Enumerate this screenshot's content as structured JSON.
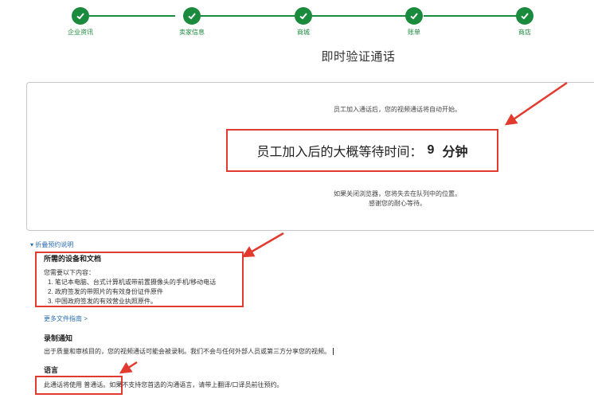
{
  "stepper": {
    "steps": [
      {
        "label": "企业资讯"
      },
      {
        "label": "卖家信息"
      },
      {
        "label": "商城"
      },
      {
        "label": "账单"
      },
      {
        "label": "商店"
      }
    ]
  },
  "page_title": "即时验证通话",
  "status_card": {
    "started_text": "员工加入通话后，您的视频通话将自动开始。",
    "wait_label": "员工加入后的大概等待时间：",
    "wait_value": "9",
    "wait_unit": "分钟",
    "close_warning": "如果关闭浏览器，您将失去在队列中的位置。",
    "thanks": "感谢您的耐心等待。"
  },
  "instructions": {
    "toggle_label": "▾ 折叠预约说明",
    "requirements_title": "所需的设备和文档",
    "requirements_intro": "您需要以下内容：",
    "requirements": [
      "1. 笔记本电脑、台式计算机或带前置摄像头的手机/移动电话",
      "2. 政府签发的带照片的有效身份证件原件",
      "3. 中国政府签发的有效营业执照原件。"
    ],
    "more_docs_link": "更多文件指南 >",
    "recording_title": "录制通知",
    "recording_text": "出于质量和审核目的，您的视频通话可能会被录制。我们不会与任何外部人员或第三方分享您的视频。",
    "language_title": "语言",
    "language_text": "此通话将使用 普通话。如果不支持您首选的沟通语言，请带上翻译/口译员前往预约。"
  },
  "colors": {
    "accent_green": "#1a8a3d",
    "annotation_red": "#e23a2f",
    "link_blue": "#2a6db0"
  }
}
